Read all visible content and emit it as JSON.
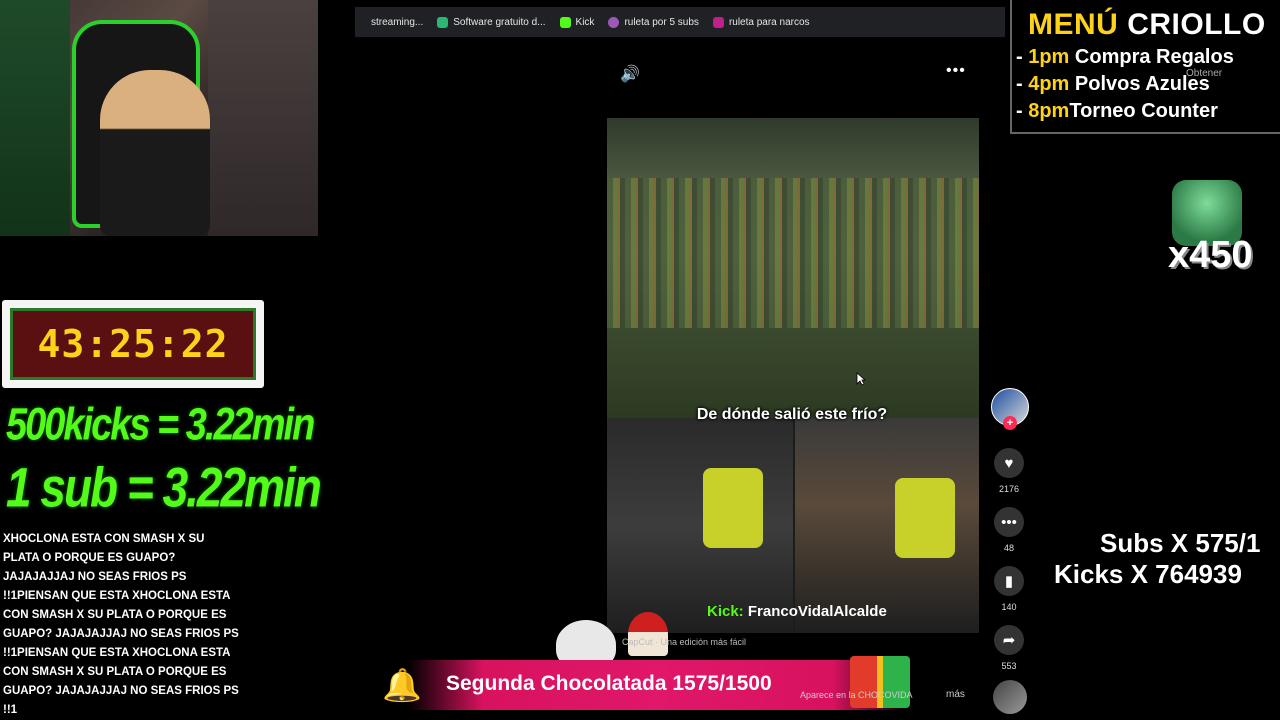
{
  "bookmarks": [
    {
      "label": "streaming...",
      "color": "#202124"
    },
    {
      "label": "Software gratuito d...",
      "color": "#2bb673"
    },
    {
      "label": "Kick",
      "color": "#53fc18"
    },
    {
      "label": "ruleta por 5 subs",
      "color": "#9b59b6"
    },
    {
      "label": "ruleta para narcos",
      "color": "#c0208a"
    }
  ],
  "video": {
    "caption": "De dónde salió este frío?",
    "kick_prefix": "Kick:",
    "kick_name": "FrancoVidalAlcalde",
    "capcut": "CapCut · Una edición más fácil",
    "more": "más",
    "sub_banner": "Aparece en la CHOCOVIDA"
  },
  "actions": {
    "likes": "2176",
    "comments": "48",
    "saves": "140",
    "shares": "553"
  },
  "menu": {
    "title_yellow": "MENÚ",
    "title_white": "CRIOLLO",
    "items": [
      {
        "time": "1pm",
        "text": "Compra Regalos"
      },
      {
        "time": "4pm",
        "text": "Polvos Azules"
      },
      {
        "time": "8pm",
        "text": "Torneo Counter"
      }
    ],
    "obtener": "Obtener"
  },
  "multiplier": "x450",
  "counters": {
    "subs": "Subs X 575/1",
    "kicks": "Kicks X 764939"
  },
  "timer": "43:25:22",
  "rules": {
    "kicks": "500kicks = 3.22min",
    "sub": "1 sub = 3.22min"
  },
  "chat_message": "XHOCLONA ESTA CON SMASH X SU PLATA O PORQUE ES GUAPO? JAJAJAJJAJ NO SEAS FRIOS PS !!1PIENSAN QUE ESTA XHOCLONA ESTA CON SMASH X SU PLATA O PORQUE ES GUAPO? JAJAJAJJAJ NO SEAS FRIOS PS !!1PIENSAN QUE ESTA XHOCLONA ESTA CON SMASH X SU PLATA O PORQUE ES GUAPO? JAJAJAJJAJ NO SEAS FRIOS PS !!1",
  "banner": "Segunda Chocolatada 1575/1500",
  "colors": {
    "kick_green": "#53fc18",
    "menu_yellow": "#ffd21a",
    "banner_pink": "#e0176a"
  }
}
